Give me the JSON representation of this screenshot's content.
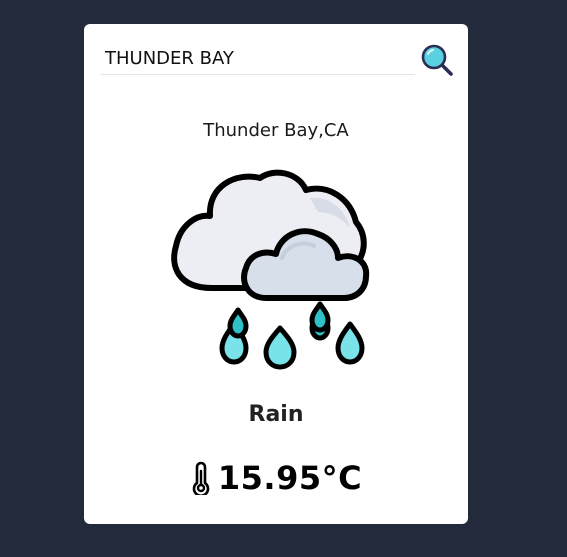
{
  "search": {
    "value": "THUNDER BAY",
    "icon": "search-icon"
  },
  "weather": {
    "location": "Thunder Bay,CA",
    "condition": "Rain",
    "condition_icon": "rain-cloud-icon",
    "temperature": "15.95°C",
    "temperature_icon": "thermometer-icon"
  },
  "colors": {
    "background": "#222a3b",
    "card": "#ffffff",
    "search_icon": "#5ad0e0",
    "raindrop": "#7ae3ea"
  }
}
